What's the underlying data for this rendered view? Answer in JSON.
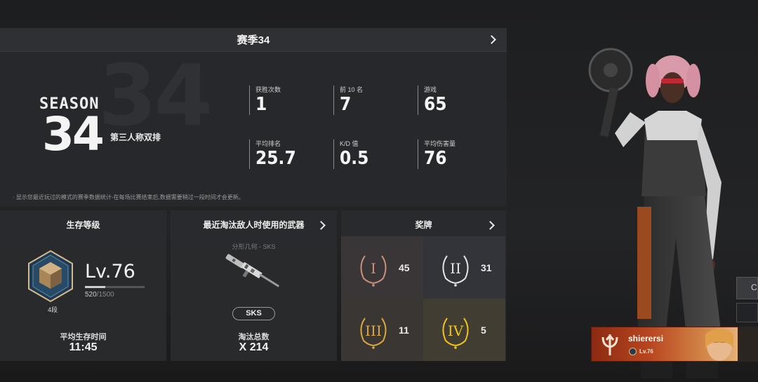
{
  "season": {
    "header_title": "赛季34",
    "bg_number": "34",
    "logo_word": "SEASON",
    "logo_number": "34",
    "mode": "第三人称双排",
    "stats": [
      {
        "label": "获胜次数",
        "value": "1"
      },
      {
        "label": "前 10 名",
        "value": "7"
      },
      {
        "label": "游戏",
        "value": "65"
      },
      {
        "label": "平均排名",
        "value": "25.7"
      },
      {
        "label": "K/D 值",
        "value": "0.5"
      },
      {
        "label": "平均伤害量",
        "value": "76"
      }
    ],
    "note": "· 显示您最近玩过的模式的赛季数据统计-在每场比赛结束后,数据需要稍过一段时间才会更新。"
  },
  "survival": {
    "title": "生存等级",
    "tier": "4段",
    "level": "Lv.76",
    "xp_current": "520",
    "xp_total": "/1500",
    "xp_fraction": 0.347,
    "avg_time_label": "平均生存时间",
    "avg_time_value": "11:45"
  },
  "weapon": {
    "title": "最近淘汰敌人时使用的武器",
    "subtitle": "分形几何 - SKS",
    "name": "SKS",
    "kills_label": "淘汰总数",
    "kills_value": "X 214"
  },
  "medals": {
    "title": "奖牌",
    "items": [
      {
        "numeral": "I",
        "count": "45",
        "color": "#c9917a"
      },
      {
        "numeral": "II",
        "count": "31",
        "color": "#e6e6e6"
      },
      {
        "numeral": "III",
        "count": "11",
        "color": "#d8a93a"
      },
      {
        "numeral": "IV",
        "count": "5",
        "color": "#f0c419"
      }
    ]
  },
  "player": {
    "name": "shierersi",
    "level": "Lv.76"
  },
  "side_button": {
    "label": "C"
  }
}
